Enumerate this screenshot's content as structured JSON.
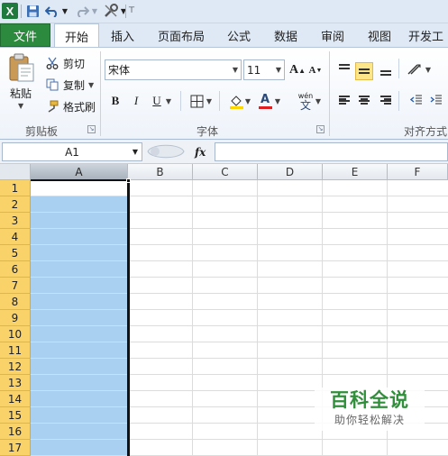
{
  "quick_access": {
    "app_icon": "excel-logo-icon",
    "app_letter": "X",
    "icons": [
      "save-icon",
      "undo-icon",
      "redo-icon",
      "customize-icon"
    ]
  },
  "tabs": {
    "file": "文件",
    "items": [
      "开始",
      "插入",
      "页面布局",
      "公式",
      "数据",
      "审阅",
      "视图",
      "开发工"
    ],
    "active": "开始"
  },
  "clipboard": {
    "paste": "粘贴",
    "cut": "剪切",
    "copy": "复制",
    "format_painter": "格式刷",
    "group_label": "剪贴板"
  },
  "font": {
    "name": "宋体",
    "size": "11",
    "grow": "A",
    "shrink": "A",
    "bold": "B",
    "italic": "I",
    "underline": "U",
    "font_color_letter": "A",
    "wen": "wén",
    "wen_char": "文",
    "group_label": "字体"
  },
  "alignment": {
    "group_label": "对齐方式"
  },
  "formula_bar": {
    "name_box": "A1",
    "fx": "fx",
    "formula": ""
  },
  "grid": {
    "columns": [
      "A",
      "B",
      "C",
      "D",
      "E",
      "F"
    ],
    "rows": [
      "1",
      "2",
      "3",
      "4",
      "5",
      "6",
      "7",
      "8",
      "9",
      "10",
      "11",
      "12",
      "13",
      "14",
      "15",
      "16",
      "17"
    ],
    "selected_column": "A",
    "selected_range_rows": "1-17"
  },
  "colors": {
    "file_tab": "#2c8a3e",
    "selection": "#a9d0f0",
    "row_header_selected": "#f9d26a",
    "align_active": "#fde58a",
    "watermark_green": "#2f8f3a"
  },
  "watermark": {
    "title": "百科全说",
    "subtitle": "助你轻松解决"
  }
}
